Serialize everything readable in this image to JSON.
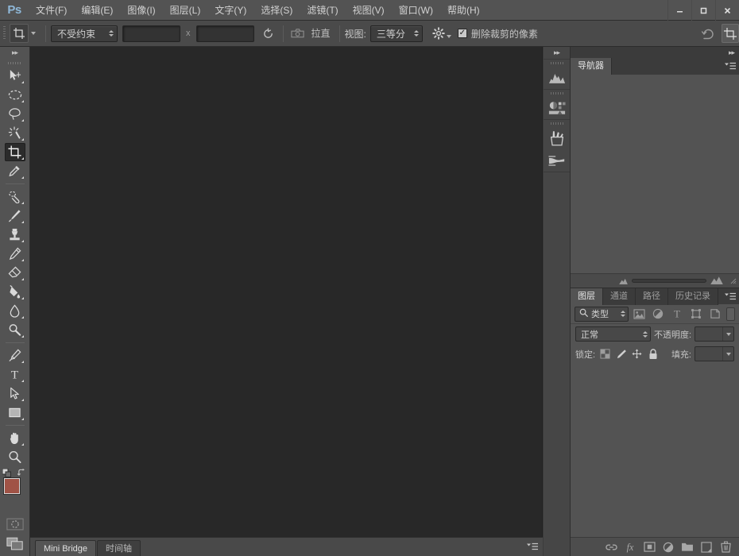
{
  "app": {
    "logo": "Ps"
  },
  "menu": {
    "items": [
      {
        "label": "文件(F)",
        "name": "menu-file"
      },
      {
        "label": "编辑(E)",
        "name": "menu-edit"
      },
      {
        "label": "图像(I)",
        "name": "menu-image"
      },
      {
        "label": "图层(L)",
        "name": "menu-layer"
      },
      {
        "label": "文字(Y)",
        "name": "menu-type"
      },
      {
        "label": "选择(S)",
        "name": "menu-select"
      },
      {
        "label": "滤镜(T)",
        "name": "menu-filter"
      },
      {
        "label": "视图(V)",
        "name": "menu-view"
      },
      {
        "label": "窗口(W)",
        "name": "menu-window"
      },
      {
        "label": "帮助(H)",
        "name": "menu-help"
      }
    ]
  },
  "window_controls": {
    "minimize": "—",
    "maximize": "❐",
    "close": "✕"
  },
  "options_bar": {
    "tool_icon": "crop-tool-icon",
    "ratio_value": "不受约束",
    "width_value": "",
    "height_value": "",
    "separator": "x",
    "swap_icon": "rotate-icon",
    "straighten_label": "拉直",
    "view_label": "视图:",
    "overlay_value": "三等分",
    "gear_icon": "gear-icon",
    "delete_cropped_label": "删除裁剪的像素",
    "delete_cropped_checked": "✓",
    "reset_icon": "reset-icon"
  },
  "toolbar": {
    "collapse_icon": "▸▸",
    "tools": [
      {
        "name": "move-tool",
        "icon": "move"
      },
      {
        "name": "marquee-tool",
        "icon": "marquee"
      },
      {
        "name": "lasso-tool",
        "icon": "lasso"
      },
      {
        "name": "magic-wand-tool",
        "icon": "wand"
      },
      {
        "name": "crop-tool",
        "icon": "crop",
        "active": true
      },
      {
        "name": "eyedropper-tool",
        "icon": "eyedropper"
      },
      {
        "name": "healing-brush-tool",
        "icon": "healing"
      },
      {
        "name": "brush-tool",
        "icon": "brush"
      },
      {
        "name": "clone-stamp-tool",
        "icon": "stamp"
      },
      {
        "name": "history-brush-tool",
        "icon": "history-brush"
      },
      {
        "name": "eraser-tool",
        "icon": "eraser"
      },
      {
        "name": "gradient-tool",
        "icon": "paint-bucket"
      },
      {
        "name": "blur-tool",
        "icon": "blur"
      },
      {
        "name": "dodge-tool",
        "icon": "dodge"
      },
      {
        "name": "pen-tool",
        "icon": "pen"
      },
      {
        "name": "type-tool",
        "icon": "type"
      },
      {
        "name": "path-selection-tool",
        "icon": "path-arrow"
      },
      {
        "name": "rectangle-tool",
        "icon": "rectangle"
      },
      {
        "name": "hand-tool",
        "icon": "hand"
      },
      {
        "name": "zoom-tool",
        "icon": "zoom"
      }
    ],
    "foreground_color": "#a05346",
    "background_color": "#f3c4e0",
    "quick_mask_icon": "quick-mask-icon",
    "screen_mode_icon": "screen-mode-icon"
  },
  "dock_strip": {
    "collapse_icon": "▸▸",
    "icons": [
      {
        "name": "histogram-panel-icon"
      },
      {
        "name": "adjustments-panel-icon"
      },
      {
        "name": "brush-presets-panel-icon"
      },
      {
        "name": "brush-panel-icon"
      }
    ]
  },
  "navigator_panel": {
    "collapse_icon": "◂◂",
    "expand_icon": "▸▸",
    "tabs": [
      {
        "label": "导航器",
        "active": true
      }
    ],
    "menu_icon": "panel-menu-icon",
    "zoom_value": "",
    "small_thumb_icon": "small-image-icon",
    "large_thumb_icon": "large-image-icon"
  },
  "layers_panel": {
    "tabs": [
      {
        "label": "图层",
        "active": true
      },
      {
        "label": "通道",
        "active": false
      },
      {
        "label": "路径",
        "active": false
      },
      {
        "label": "历史记录",
        "active": false
      }
    ],
    "menu_icon": "panel-menu-icon",
    "filter": {
      "search_icon": "search-icon",
      "type_value": "类型",
      "icons": [
        {
          "name": "filter-pixel-icon"
        },
        {
          "name": "filter-adjustment-icon"
        },
        {
          "name": "filter-type-icon"
        },
        {
          "name": "filter-shape-icon"
        },
        {
          "name": "filter-smart-object-icon"
        }
      ],
      "toggle_name": "filter-enable-toggle"
    },
    "blend_mode": "正常",
    "opacity_label": "不透明度:",
    "opacity_value": "",
    "lock_label": "锁定:",
    "lock_icons": [
      {
        "name": "lock-transparent-pixels-icon"
      },
      {
        "name": "lock-image-pixels-icon"
      },
      {
        "name": "lock-position-icon"
      },
      {
        "name": "lock-all-icon"
      }
    ],
    "fill_label": "填充:",
    "fill_value": "",
    "footer_icons": [
      {
        "name": "link-layers-icon"
      },
      {
        "name": "layer-style-fx-icon"
      },
      {
        "name": "layer-mask-icon"
      },
      {
        "name": "adjustment-layer-icon"
      },
      {
        "name": "new-group-icon"
      },
      {
        "name": "new-layer-icon"
      },
      {
        "name": "delete-layer-icon"
      }
    ]
  },
  "status_bar": {
    "tabs": [
      {
        "label": "Mini Bridge",
        "active": true
      },
      {
        "label": "时间轴",
        "active": false
      }
    ],
    "menu_icon": "panel-menu-icon"
  },
  "colors": {
    "titlebar_bg": "#535353",
    "optionsbar_bg": "#4a4a4a",
    "canvas_bg": "#282828",
    "panel_bg": "#535353",
    "dock_bg": "#3b3b3b",
    "accent_logo": "#8fb8d8"
  }
}
